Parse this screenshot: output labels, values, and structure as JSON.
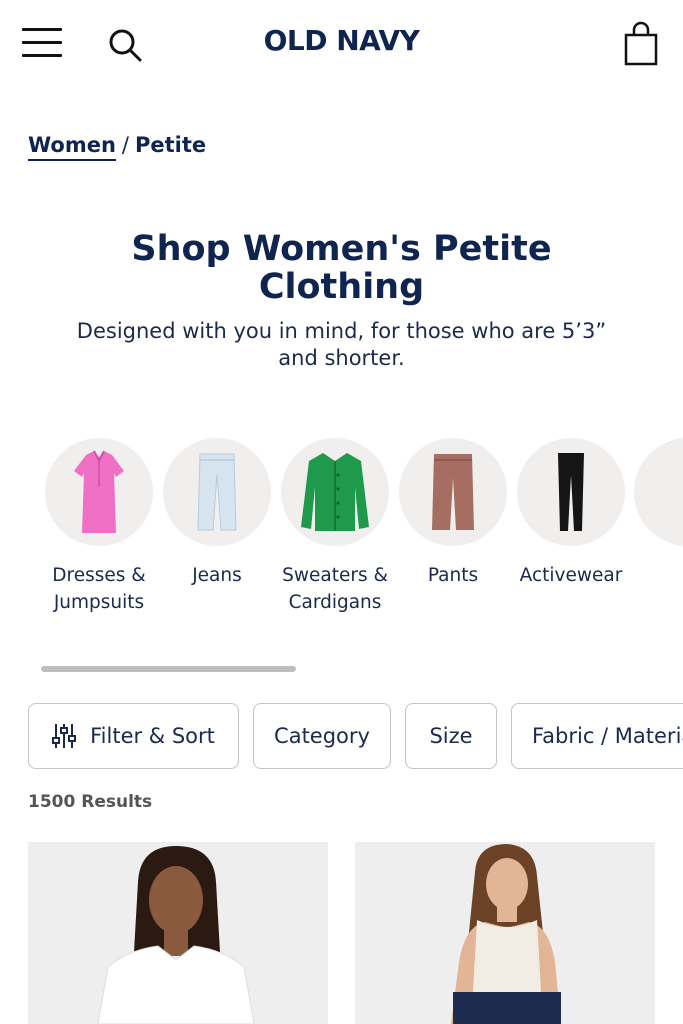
{
  "header": {
    "logo": "OLD NAVY",
    "menu_icon": "hamburger-menu-icon",
    "search_icon": "search-icon",
    "bag_icon": "shopping-bag-icon"
  },
  "breadcrumb": {
    "parent": "Women",
    "separator": "/",
    "current": "Petite"
  },
  "hero": {
    "title": "Shop Women's Petite Clothing",
    "subtitle": "Designed with you in mind, for those who are 5’3” and shorter."
  },
  "categories": [
    {
      "label": "Dresses & Jumpsuits",
      "icon": "pink-dress-icon"
    },
    {
      "label": "Jeans",
      "icon": "light-jeans-icon"
    },
    {
      "label": "Sweaters & Cardigans",
      "icon": "green-cardigan-icon"
    },
    {
      "label": "Pants",
      "icon": "brown-pants-icon"
    },
    {
      "label": "Activewear",
      "icon": "black-leggings-icon"
    }
  ],
  "filters": {
    "filter_sort": "Filter & Sort",
    "filter_icon": "sliders-icon",
    "category": "Category",
    "size": "Size",
    "fabric": "Fabric / Material"
  },
  "results": {
    "count_label": "1500 Results"
  },
  "colors": {
    "navy": "#0f2550",
    "text": "#1b2a4a",
    "chip_border": "#c4c4c4",
    "circle_bg": "#f1efed"
  }
}
